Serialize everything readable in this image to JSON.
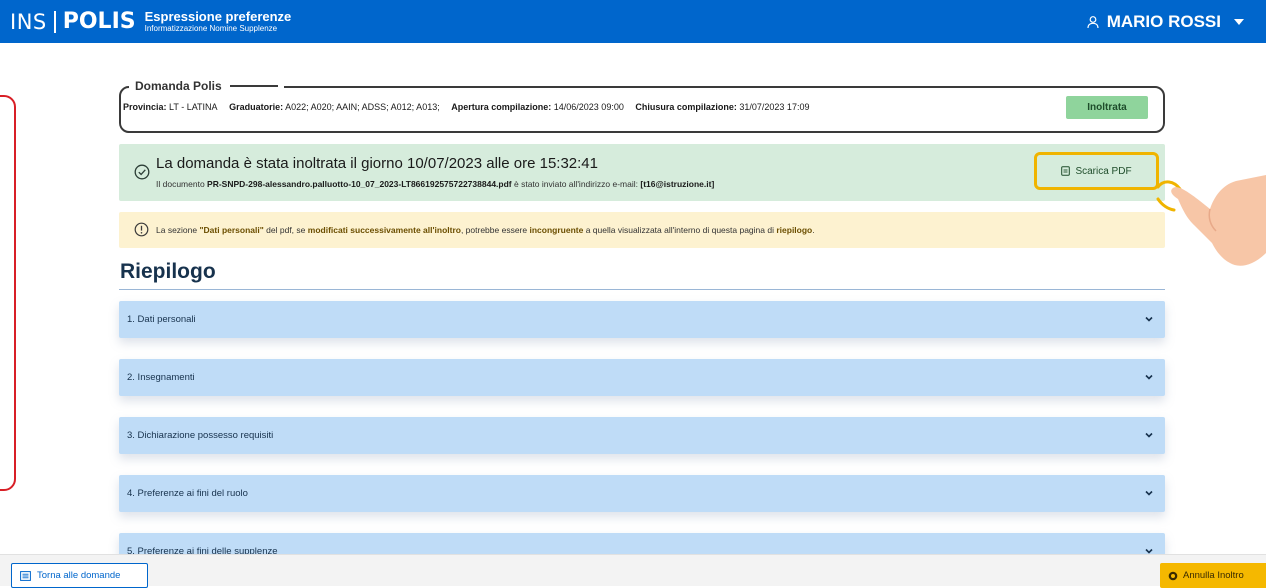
{
  "header": {
    "logo_ins": "INS",
    "logo_polis": "POLIS",
    "app_title": "Espressione preferenze",
    "app_subtitle": "Informatizzazione Nomine Supplenze",
    "user_name": "MARIO ROSSI",
    "brand_color": "#0066cc"
  },
  "domanda": {
    "legend": "Domanda Polis",
    "provincia_label": "Provincia:",
    "provincia_value": "LT - LATINA",
    "graduatorie_label": "Graduatorie:",
    "graduatorie_value": "A022; A020; AAIN; ADSS; A012; A013;",
    "apertura_label": "Apertura compilazione:",
    "apertura_value": "14/06/2023 09:00",
    "chiusura_label": "Chiusura compilazione:",
    "chiusura_value": "31/07/2023 17:09",
    "status": "Inoltrata"
  },
  "success_alert": {
    "title": "La domanda è stata inoltrata il giorno 10/07/2023 alle ore 15:32:41",
    "text_prefix": "Il documento",
    "filename": "PR-SNPD-298-alessandro.palluotto-10_07_2023-LT866192575722738844.pdf",
    "text_middle": "è stato inviato all'indirizzo e-mail:",
    "email": "[t16@istruzione.it]",
    "pdf_button": "Scarica PDF"
  },
  "warning": {
    "t1": "La sezione",
    "b1": "\"Dati personali\"",
    "t2": "del pdf, se",
    "b2": "modificati successivamente all'inoltro",
    "t3": ", potrebbe essere",
    "b3": "incongruente",
    "t4": "a quella visualizzata all'interno di questa pagina di",
    "b4": "riepilogo",
    "t5": "."
  },
  "riepilogo": {
    "title": "Riepilogo",
    "sections": [
      "1. Dati personali",
      "2. Insegnamenti",
      "3. Dichiarazione possesso requisiti",
      "4. Preferenze ai fini del ruolo",
      "5. Preferenze ai fini delle supplenze"
    ]
  },
  "footer": {
    "back_button": "Torna alle domande",
    "annulla_button": "Annulla Inoltro"
  }
}
